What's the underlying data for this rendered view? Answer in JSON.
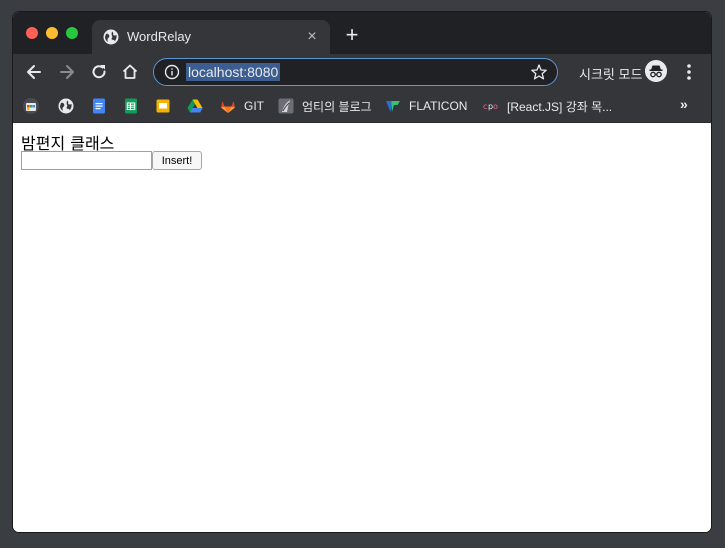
{
  "browser": {
    "tab": {
      "title": "WordRelay",
      "close_glyph": "×"
    },
    "new_tab_glyph": "+",
    "address_bar": {
      "url": "localhost:8080"
    },
    "profile": {
      "label": "시크릿 모드"
    },
    "bookmarks": [
      {
        "icon": "chrome-web-store-icon",
        "label": ""
      },
      {
        "icon": "globe-icon",
        "label": ""
      },
      {
        "icon": "google-docs-icon",
        "label": ""
      },
      {
        "icon": "google-sheets-icon",
        "label": ""
      },
      {
        "icon": "google-slides-icon",
        "label": ""
      },
      {
        "icon": "google-drive-icon",
        "label": ""
      },
      {
        "icon": "gitlab-icon",
        "label": "GIT"
      },
      {
        "icon": "blog-avatar-icon",
        "label": "엄티의 블로그"
      },
      {
        "icon": "flaticon-icon",
        "label": "FLATICON"
      },
      {
        "icon": "react-course-icon",
        "label": "[React.JS] 강좌 목..."
      }
    ],
    "bookmarks_overflow": "»"
  },
  "page": {
    "heading": "밤편지 클래스",
    "input": {
      "value": "",
      "placeholder": ""
    },
    "insert_button": "Insert!"
  },
  "colors": {
    "close": "#fe5f57",
    "minimize": "#febc2e",
    "maximize": "#28c840",
    "omnibox_focus": "#5e94d4"
  }
}
